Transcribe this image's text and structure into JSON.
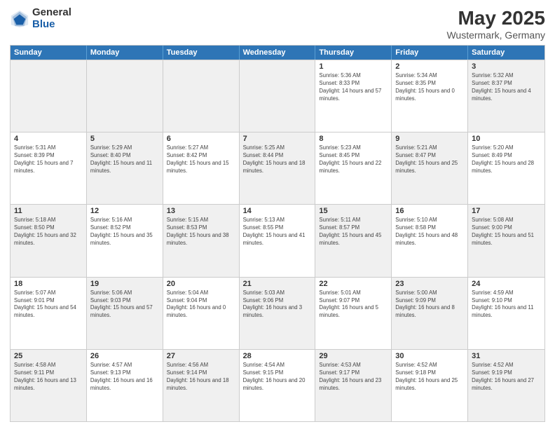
{
  "logo": {
    "general": "General",
    "blue": "Blue"
  },
  "title": "May 2025",
  "subtitle": "Wustermark, Germany",
  "days_of_week": [
    "Sunday",
    "Monday",
    "Tuesday",
    "Wednesday",
    "Thursday",
    "Friday",
    "Saturday"
  ],
  "rows": [
    [
      {
        "day": "",
        "info": "",
        "shaded": true
      },
      {
        "day": "",
        "info": "",
        "shaded": true
      },
      {
        "day": "",
        "info": "",
        "shaded": true
      },
      {
        "day": "",
        "info": "",
        "shaded": true
      },
      {
        "day": "1",
        "sunrise": "Sunrise: 5:36 AM",
        "sunset": "Sunset: 8:33 PM",
        "daylight": "Daylight: 14 hours and 57 minutes."
      },
      {
        "day": "2",
        "sunrise": "Sunrise: 5:34 AM",
        "sunset": "Sunset: 8:35 PM",
        "daylight": "Daylight: 15 hours and 0 minutes."
      },
      {
        "day": "3",
        "sunrise": "Sunrise: 5:32 AM",
        "sunset": "Sunset: 8:37 PM",
        "daylight": "Daylight: 15 hours and 4 minutes.",
        "shaded": true
      }
    ],
    [
      {
        "day": "4",
        "sunrise": "Sunrise: 5:31 AM",
        "sunset": "Sunset: 8:39 PM",
        "daylight": "Daylight: 15 hours and 7 minutes."
      },
      {
        "day": "5",
        "sunrise": "Sunrise: 5:29 AM",
        "sunset": "Sunset: 8:40 PM",
        "daylight": "Daylight: 15 hours and 11 minutes.",
        "shaded": true
      },
      {
        "day": "6",
        "sunrise": "Sunrise: 5:27 AM",
        "sunset": "Sunset: 8:42 PM",
        "daylight": "Daylight: 15 hours and 15 minutes."
      },
      {
        "day": "7",
        "sunrise": "Sunrise: 5:25 AM",
        "sunset": "Sunset: 8:44 PM",
        "daylight": "Daylight: 15 hours and 18 minutes.",
        "shaded": true
      },
      {
        "day": "8",
        "sunrise": "Sunrise: 5:23 AM",
        "sunset": "Sunset: 8:45 PM",
        "daylight": "Daylight: 15 hours and 22 minutes."
      },
      {
        "day": "9",
        "sunrise": "Sunrise: 5:21 AM",
        "sunset": "Sunset: 8:47 PM",
        "daylight": "Daylight: 15 hours and 25 minutes.",
        "shaded": true
      },
      {
        "day": "10",
        "sunrise": "Sunrise: 5:20 AM",
        "sunset": "Sunset: 8:49 PM",
        "daylight": "Daylight: 15 hours and 28 minutes."
      }
    ],
    [
      {
        "day": "11",
        "sunrise": "Sunrise: 5:18 AM",
        "sunset": "Sunset: 8:50 PM",
        "daylight": "Daylight: 15 hours and 32 minutes.",
        "shaded": true
      },
      {
        "day": "12",
        "sunrise": "Sunrise: 5:16 AM",
        "sunset": "Sunset: 8:52 PM",
        "daylight": "Daylight: 15 hours and 35 minutes."
      },
      {
        "day": "13",
        "sunrise": "Sunrise: 5:15 AM",
        "sunset": "Sunset: 8:53 PM",
        "daylight": "Daylight: 15 hours and 38 minutes.",
        "shaded": true
      },
      {
        "day": "14",
        "sunrise": "Sunrise: 5:13 AM",
        "sunset": "Sunset: 8:55 PM",
        "daylight": "Daylight: 15 hours and 41 minutes."
      },
      {
        "day": "15",
        "sunrise": "Sunrise: 5:11 AM",
        "sunset": "Sunset: 8:57 PM",
        "daylight": "Daylight: 15 hours and 45 minutes.",
        "shaded": true
      },
      {
        "day": "16",
        "sunrise": "Sunrise: 5:10 AM",
        "sunset": "Sunset: 8:58 PM",
        "daylight": "Daylight: 15 hours and 48 minutes."
      },
      {
        "day": "17",
        "sunrise": "Sunrise: 5:08 AM",
        "sunset": "Sunset: 9:00 PM",
        "daylight": "Daylight: 15 hours and 51 minutes.",
        "shaded": true
      }
    ],
    [
      {
        "day": "18",
        "sunrise": "Sunrise: 5:07 AM",
        "sunset": "Sunset: 9:01 PM",
        "daylight": "Daylight: 15 hours and 54 minutes."
      },
      {
        "day": "19",
        "sunrise": "Sunrise: 5:06 AM",
        "sunset": "Sunset: 9:03 PM",
        "daylight": "Daylight: 15 hours and 57 minutes.",
        "shaded": true
      },
      {
        "day": "20",
        "sunrise": "Sunrise: 5:04 AM",
        "sunset": "Sunset: 9:04 PM",
        "daylight": "Daylight: 16 hours and 0 minutes."
      },
      {
        "day": "21",
        "sunrise": "Sunrise: 5:03 AM",
        "sunset": "Sunset: 9:06 PM",
        "daylight": "Daylight: 16 hours and 3 minutes.",
        "shaded": true
      },
      {
        "day": "22",
        "sunrise": "Sunrise: 5:01 AM",
        "sunset": "Sunset: 9:07 PM",
        "daylight": "Daylight: 16 hours and 5 minutes."
      },
      {
        "day": "23",
        "sunrise": "Sunrise: 5:00 AM",
        "sunset": "Sunset: 9:09 PM",
        "daylight": "Daylight: 16 hours and 8 minutes.",
        "shaded": true
      },
      {
        "day": "24",
        "sunrise": "Sunrise: 4:59 AM",
        "sunset": "Sunset: 9:10 PM",
        "daylight": "Daylight: 16 hours and 11 minutes."
      }
    ],
    [
      {
        "day": "25",
        "sunrise": "Sunrise: 4:58 AM",
        "sunset": "Sunset: 9:11 PM",
        "daylight": "Daylight: 16 hours and 13 minutes.",
        "shaded": true
      },
      {
        "day": "26",
        "sunrise": "Sunrise: 4:57 AM",
        "sunset": "Sunset: 9:13 PM",
        "daylight": "Daylight: 16 hours and 16 minutes."
      },
      {
        "day": "27",
        "sunrise": "Sunrise: 4:56 AM",
        "sunset": "Sunset: 9:14 PM",
        "daylight": "Daylight: 16 hours and 18 minutes.",
        "shaded": true
      },
      {
        "day": "28",
        "sunrise": "Sunrise: 4:54 AM",
        "sunset": "Sunset: 9:15 PM",
        "daylight": "Daylight: 16 hours and 20 minutes."
      },
      {
        "day": "29",
        "sunrise": "Sunrise: 4:53 AM",
        "sunset": "Sunset: 9:17 PM",
        "daylight": "Daylight: 16 hours and 23 minutes.",
        "shaded": true
      },
      {
        "day": "30",
        "sunrise": "Sunrise: 4:52 AM",
        "sunset": "Sunset: 9:18 PM",
        "daylight": "Daylight: 16 hours and 25 minutes."
      },
      {
        "day": "31",
        "sunrise": "Sunrise: 4:52 AM",
        "sunset": "Sunset: 9:19 PM",
        "daylight": "Daylight: 16 hours and 27 minutes.",
        "shaded": true
      }
    ]
  ]
}
